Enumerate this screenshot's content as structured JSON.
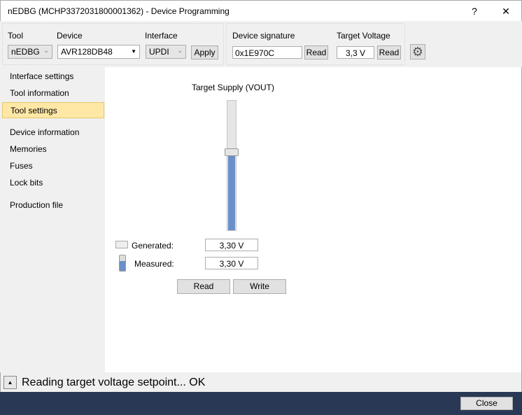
{
  "window": {
    "title": "nEDBG (MCHP3372031800001362) - Device Programming",
    "help": "?",
    "close": "✕"
  },
  "toolbar": {
    "tool_label": "Tool",
    "tool_value": "nEDBG",
    "device_label": "Device",
    "device_value": "AVR128DB48",
    "interface_label": "Interface",
    "interface_value": "UPDI",
    "apply": "Apply",
    "signature_label": "Device signature",
    "signature_value": "0x1E970C",
    "signature_read": "Read",
    "voltage_label": "Target Voltage",
    "voltage_value": "3,3 V",
    "voltage_read": "Read"
  },
  "sidebar": {
    "items": [
      {
        "label": "Interface settings"
      },
      {
        "label": "Tool information"
      },
      {
        "label": "Tool settings"
      },
      {
        "label": "Device information"
      },
      {
        "label": "Memories"
      },
      {
        "label": "Fuses"
      },
      {
        "label": "Lock bits"
      },
      {
        "label": "Production file"
      }
    ],
    "selected": 2
  },
  "main": {
    "slider_title": "Target Supply (VOUT)",
    "slider_fraction": 0.6,
    "generated_label": "Generated:",
    "generated_value": "3,30 V",
    "measured_label": "Measured:",
    "measured_value": "3,30 V",
    "read": "Read",
    "write": "Write"
  },
  "status": {
    "text": "Reading target voltage setpoint... OK"
  },
  "footer": {
    "close": "Close"
  },
  "colors": {
    "accent": "#6b8fc9",
    "footer": "#293955",
    "selected": "#ffe8a6"
  }
}
